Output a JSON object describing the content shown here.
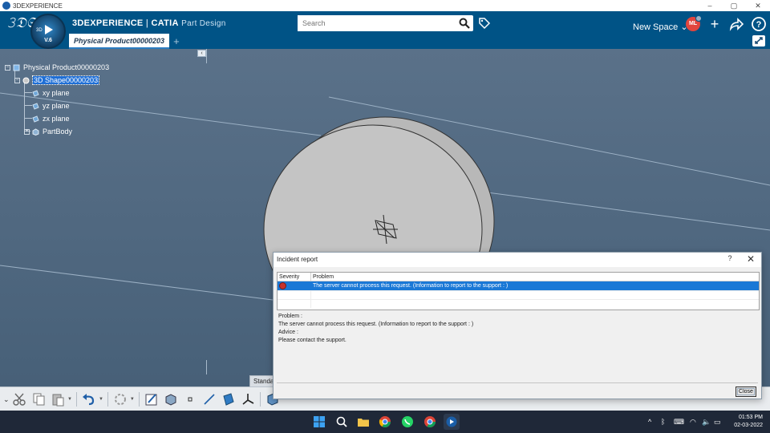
{
  "window": {
    "title": "3DEXPERIENCE",
    "controls": [
      "–",
      "▢",
      "✕"
    ]
  },
  "header": {
    "brand_main": "3DEXPERIENCE",
    "brand_sep": " | ",
    "brand_product": "CATIA",
    "brand_app": "Part Design",
    "compass_version": "V.6",
    "compass_label": "3D",
    "document_tab": "Physical Product00000203",
    "add_tab": "+",
    "search_placeholder": "Search",
    "new_space_label": "New Space",
    "user_initials": "ML"
  },
  "tree": {
    "root": "Physical Product00000203",
    "shape": "3D Shape00000203",
    "children": [
      "xy plane",
      "yz plane",
      "zx plane",
      "PartBody"
    ]
  },
  "toolbar": {
    "tab_label": "Standard",
    "collapse_glyph": "‹"
  },
  "dialog": {
    "title": "Incident report",
    "help": "?",
    "close_x": "✕",
    "columns": [
      "Severity",
      "Problem"
    ],
    "rows": [
      {
        "severity": "error",
        "problem": "The server cannot process this request. (Information to report to the support : )"
      }
    ],
    "problem_label": "Problem :",
    "problem_text": "The server cannot process this request. (Information to report to the support : )",
    "advice_label": "Advice :",
    "advice_text": "Please contact the support.",
    "close_button": "Close"
  },
  "taskbar": {
    "time": "01:53 PM",
    "date": "02-03-2022"
  },
  "colors": {
    "header_bg": "#005386",
    "viewport_bg": "#4f6a84",
    "selection_blue": "#1a78d6",
    "error_red": "#c7322c",
    "avatar_red": "#e2453d"
  }
}
